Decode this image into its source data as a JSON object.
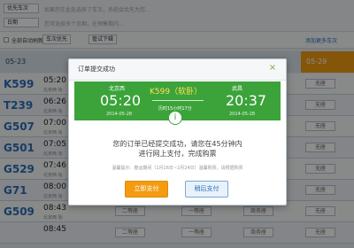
{
  "filters": {
    "type_select": "优先车次",
    "type_hint": "如果您在此处选择了车次，系统会优先为您...",
    "date_select": "日期",
    "date_hint": "您可选择多个日期，在预售期内..."
  },
  "options": {
    "auto_query": "全部自动刷新",
    "train_select": "车次优先",
    "mode_select": "管试下辑",
    "right_link": "添加更多车次"
  },
  "dates": {
    "first": "05-23",
    "last": "05-29",
    "active": "05-29"
  },
  "trains": [
    {
      "no": "K599",
      "time": "05:20",
      "sub": "北京西 始"
    },
    {
      "no": "T239",
      "time": "06:26",
      "sub": "北京西 始"
    },
    {
      "no": "G507",
      "time": "07:00",
      "sub": "北京西 始"
    },
    {
      "no": "G501",
      "time": "07:05",
      "sub": "北京西 始"
    },
    {
      "no": "G529",
      "time": "07:46",
      "sub": "北京西 始"
    },
    {
      "no": "G71",
      "time": "08:00",
      "sub": "北京西 始"
    },
    {
      "no": "G509",
      "time": "08:43",
      "sub": "北京西 始"
    },
    {
      "no": "",
      "time": "08:45",
      "sub": ""
    }
  ],
  "seat_labels": {
    "none": "无座",
    "second": "二等座",
    "first": "一等座",
    "business": "商务座"
  },
  "dialog": {
    "title": "订单提交成功",
    "close_symbol": "×",
    "from_station": "北京西",
    "to_station": "武昌",
    "depart_time": "05:20",
    "arrive_time": "20:37",
    "depart_date": "2014-05-28",
    "arrive_date": "2014-05-28",
    "train_label": "K599（软卧）",
    "duration": "历时15小时17分",
    "info_symbol": "i",
    "message_line1": "您的订单已经提交成功，请您在45分钟内",
    "message_line2": "进行网上支付，完成购票",
    "tip": "温馨提示：春运期间（1月16日~2月24日）温馨购票，请根据购票",
    "pay_button": "立即支付",
    "later_button": "稍后支付"
  },
  "colors": {
    "banner_green": "#3ba33a",
    "pay_orange": "#f39c12",
    "train_blue": "#2a6ebb"
  }
}
